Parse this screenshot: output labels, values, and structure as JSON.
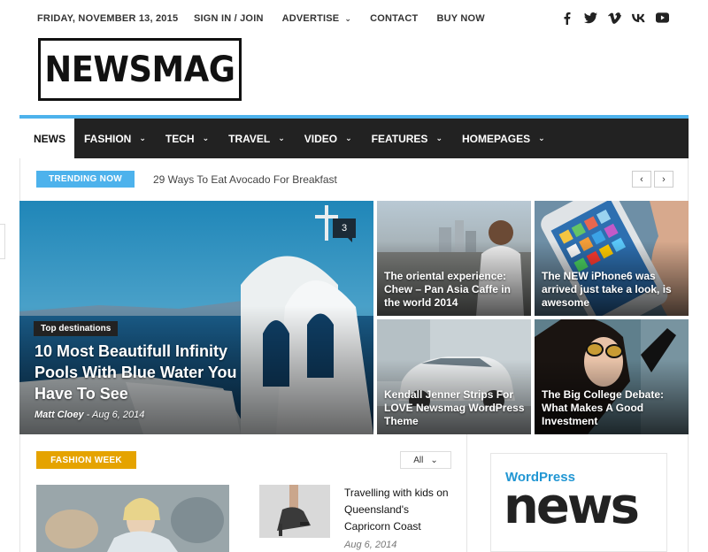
{
  "topbar": {
    "date": "FRIDAY, NOVEMBER 13, 2015",
    "menu": [
      {
        "label": "SIGN IN / JOIN",
        "caret": false
      },
      {
        "label": "ADVERTISE",
        "caret": true
      },
      {
        "label": "CONTACT",
        "caret": false
      },
      {
        "label": "BUY NOW",
        "caret": false
      }
    ],
    "socials": [
      "facebook-icon",
      "twitter-icon",
      "vimeo-icon",
      "vk-icon",
      "youtube-icon"
    ]
  },
  "logo": {
    "text": "NEWSMAG"
  },
  "nav": {
    "items": [
      {
        "label": "NEWS",
        "active": true,
        "caret": false
      },
      {
        "label": "FASHION",
        "caret": true
      },
      {
        "label": "TECH",
        "caret": true
      },
      {
        "label": "TRAVEL",
        "caret": true
      },
      {
        "label": "VIDEO",
        "caret": true
      },
      {
        "label": "FEATURES",
        "caret": true
      },
      {
        "label": "HOMEPAGES",
        "caret": true
      }
    ],
    "search_icon": "search-icon"
  },
  "trending": {
    "badge": "TRENDING NOW",
    "text": "29 Ways To Eat Avocado For Breakfast",
    "prev": "‹",
    "next": "›"
  },
  "featured": {
    "main": {
      "category": "Top destinations",
      "title": "10 Most Beautifull Infinity Pools With Blue Water You Have To See",
      "author": "Matt Cloey",
      "separator": " - ",
      "date": "Aug 6, 2014",
      "comments": "3"
    },
    "tiles": [
      {
        "title": "The oriental experience: Chew – Pan Asia Caffe in the world 2014"
      },
      {
        "title": "The NEW iPhone6 was arrived just take a look, is awesome"
      },
      {
        "title": "Kendall Jenner Strips For LOVE Newsmag WordPress Theme"
      },
      {
        "title": "The Big College Debate: What Makes A Good Investment"
      }
    ]
  },
  "fashion": {
    "badge": "FASHION WEEK",
    "filter": "All",
    "side_post": {
      "title": "Travelling with kids on Queensland's Capricorn Coast",
      "date": "Aug 6, 2014"
    }
  },
  "sidebar": {
    "wp_small": "WordPress",
    "wp_big": "news"
  },
  "colors": {
    "accent": "#4db2ec",
    "nav_bg": "#222222",
    "fashion": "#e5a300"
  }
}
